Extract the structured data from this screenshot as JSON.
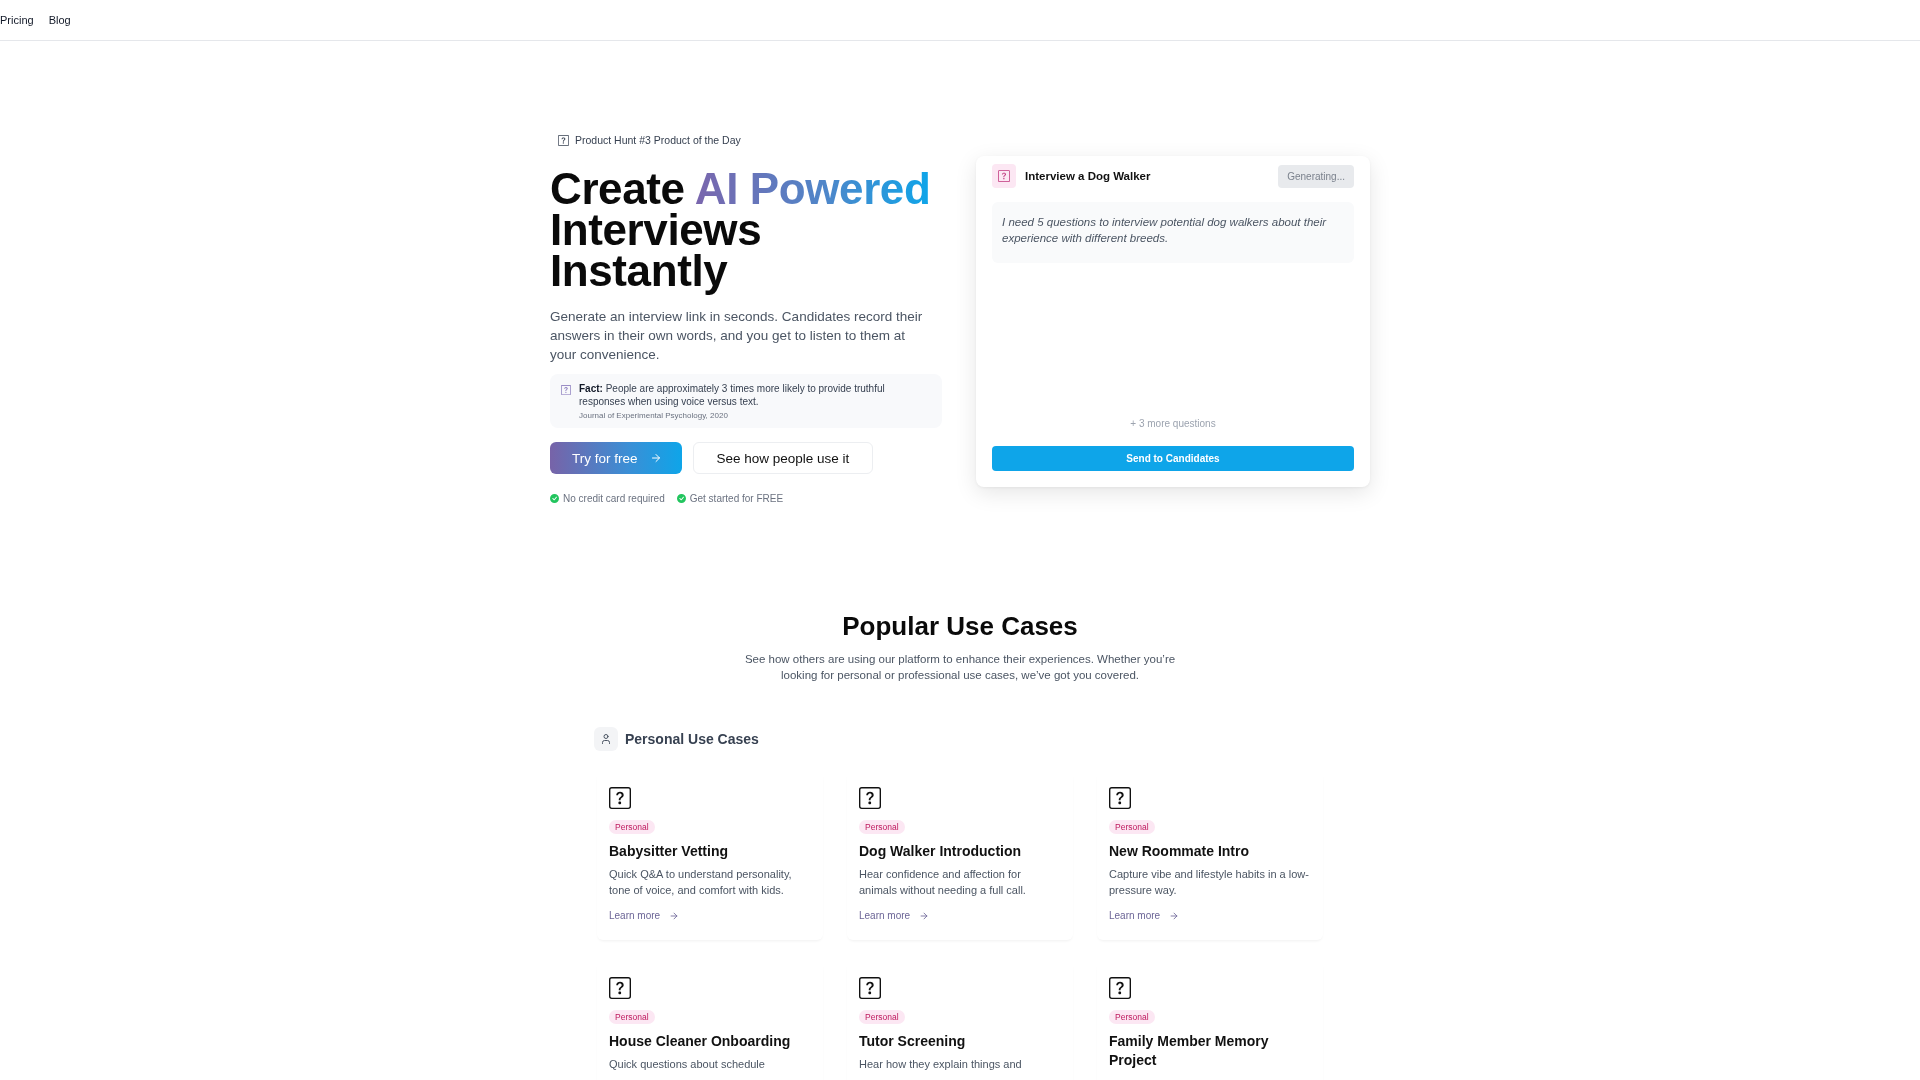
{
  "nav": {
    "links": [
      {
        "label": "Pricing"
      },
      {
        "label": "Blog"
      }
    ]
  },
  "hero": {
    "badge": "Product Hunt #3 Product of the Day",
    "headline_lines": [
      [
        {
          "text": "Create",
          "highlight": false
        },
        {
          "text": "AI Powered",
          "highlight": true
        }
      ],
      [
        {
          "text": "Interviews",
          "highlight": false
        }
      ],
      [
        {
          "text": "Instantly",
          "highlight": false
        }
      ]
    ],
    "description": "Generate an interview link in seconds. Candidates record their answers in their own words, and you get to listen to them at your convenience.",
    "fact": {
      "text": "**Fact:** People are approximately 3 times more likely to provide truthful responses when using voice versus text.",
      "source": "Journal of Experimental Psychology, 2020"
    },
    "buttons": [
      {
        "label": "Try for free",
        "kind": "primary"
      },
      {
        "label": "See how people use it",
        "kind": "secondary"
      }
    ],
    "perks": [
      "No credit card required",
      "Get started for FREE"
    ]
  },
  "demo_card": {
    "title": "Interview a Dog Walker",
    "status_button": {
      "label": "Generating...",
      "disabled": true
    },
    "prompt": "I need 5 questions to interview potential dog walkers about their experience with different breeds.",
    "more_questions": "+ 3 more questions",
    "send_button": "Send to Candidates"
  },
  "use_cases": {
    "title": "Popular Use Cases",
    "subtitle": "See how others are using our platform to enhance their experiences. Whether you’re looking for personal or professional use cases, we’ve got you covered.",
    "group": {
      "label": "Personal Use Cases",
      "cards": [
        {
          "tag": "Personal",
          "title": "Babysitter Vetting",
          "description": "Quick Q&A to understand personality, tone of voice, and comfort with kids.",
          "link": "Learn more"
        },
        {
          "tag": "Personal",
          "title": "Dog Walker Introduction",
          "description": "Hear confidence and affection for animals without needing a full call.",
          "link": "Learn more"
        },
        {
          "tag": "Personal",
          "title": "New Roommate Intro",
          "description": "Capture vibe and lifestyle habits in a low-pressure way.",
          "link": "Learn more"
        },
        {
          "tag": "Personal",
          "title": "House Cleaner Onboarding",
          "description": "Quick questions about schedule"
        },
        {
          "tag": "Personal",
          "title": "Tutor Screening",
          "description": "Hear how they explain things and"
        },
        {
          "tag": "Personal",
          "title": "Family Member Memory Project"
        }
      ]
    }
  }
}
